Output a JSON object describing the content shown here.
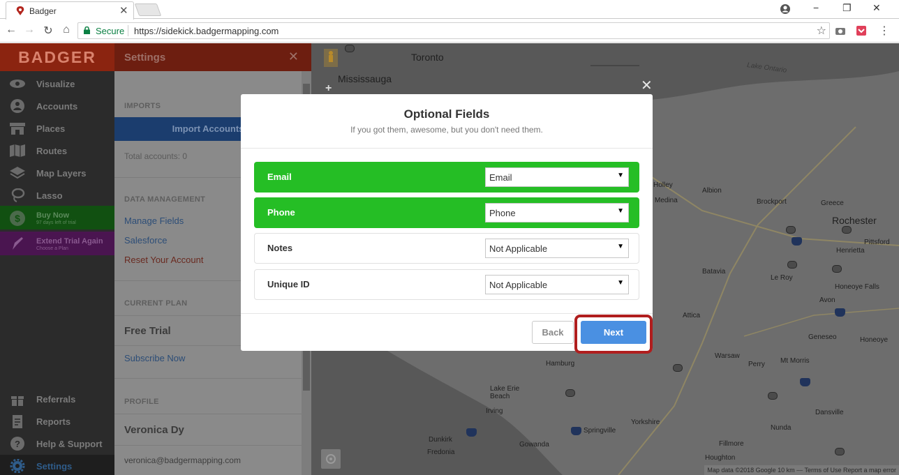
{
  "browser": {
    "tab_title": "Badger",
    "tab_close": "✕",
    "window_controls": [
      "−",
      "❐",
      "✕"
    ],
    "secure_label": "Secure",
    "url": "https://sidekick.badgermapping.com"
  },
  "sidebar": {
    "logo": "BADGER",
    "nav": [
      {
        "label": "Visualize",
        "icon": "eye-icon"
      },
      {
        "label": "Accounts",
        "icon": "person-icon"
      },
      {
        "label": "Places",
        "icon": "store-icon"
      },
      {
        "label": "Routes",
        "icon": "map-icon"
      },
      {
        "label": "Map Layers",
        "icon": "layers-icon"
      },
      {
        "label": "Lasso",
        "icon": "lasso-icon"
      }
    ],
    "buy_now": {
      "label": "Buy Now",
      "sub": "97 days left of trial"
    },
    "extend_trial": {
      "label": "Extend Trial Again",
      "sub": "Choose a Plan"
    },
    "bottom_nav": [
      {
        "label": "Referrals",
        "icon": "gift-icon"
      },
      {
        "label": "Reports",
        "icon": "report-icon"
      },
      {
        "label": "Help & Support",
        "icon": "help-icon"
      },
      {
        "label": "Settings",
        "icon": "gear-icon"
      }
    ]
  },
  "settings_panel": {
    "title": "Settings",
    "close": "✕",
    "imports_header": "IMPORTS",
    "import_button": "Import Accounts",
    "total_accounts": "Total accounts: 0",
    "data_mgmt_header": "DATA MANAGEMENT",
    "manage_fields": "Manage Fields",
    "salesforce": "Salesforce",
    "reset_account": "Reset Your Account",
    "current_plan_header": "CURRENT PLAN",
    "plan_name": "Free Trial",
    "subscribe": "Subscribe Now",
    "profile_header": "PROFILE",
    "profile_name": "Veronica Dy",
    "profile_email": "veronica@badgermapping.com"
  },
  "map": {
    "cities_large": [
      "Toronto",
      "Mississauga",
      "Rochester"
    ],
    "cities": [
      "Lake Ontario",
      "Holley",
      "Albion",
      "Medina",
      "Brockport",
      "Greece",
      "Henrietta",
      "Pittsford",
      "Batavia",
      "Le Roy",
      "Honeoye Falls",
      "Avon",
      "Attica",
      "Geneseo",
      "Honeoye",
      "Warsaw",
      "Perry",
      "Mt Morris",
      "Hamburg",
      "Lake Erie Beach",
      "Irving",
      "Dunkirk",
      "Fredonia",
      "Gowanda",
      "Springville",
      "Yorkshire",
      "Nunda",
      "Dansville",
      "Fillmore",
      "Houghton"
    ],
    "attribution": "Map data ©2018 Google   10 km ⎯⎯   Terms of Use   Report a map error"
  },
  "modal": {
    "close": "✕",
    "title": "Optional Fields",
    "subtitle": "If you got them, awesome, but you don't need them.",
    "rows": [
      {
        "label": "Email",
        "value": "Email",
        "mapped": true
      },
      {
        "label": "Phone",
        "value": "Phone",
        "mapped": true
      },
      {
        "label": "Notes",
        "value": "Not Applicable",
        "mapped": false
      },
      {
        "label": "Unique ID",
        "value": "Not Applicable",
        "mapped": false
      }
    ],
    "back_label": "Back",
    "next_label": "Next"
  },
  "colors": {
    "mapped_row": "#25be25",
    "next_button": "#4a90e2",
    "highlight": "#b01e1e"
  }
}
